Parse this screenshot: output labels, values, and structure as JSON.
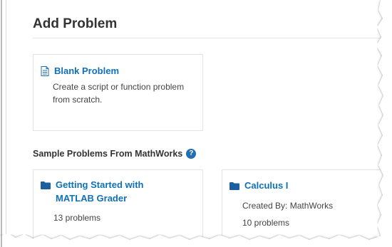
{
  "page": {
    "title": "Add Problem"
  },
  "blank_problem": {
    "label": "Blank Problem",
    "description": "Create a script or function problem from scratch.",
    "icon": "document-icon"
  },
  "samples": {
    "heading": "Sample Problems From MathWorks",
    "help_icon_glyph": "?",
    "cards": [
      {
        "title": "Getting Started with MATLAB Grader",
        "count": "13 problems",
        "icon": "folder-icon"
      },
      {
        "title": "Calculus I",
        "created_by": "Created By: MathWorks",
        "count": "10 problems",
        "icon": "folder-icon"
      }
    ]
  },
  "colors": {
    "link": "#0e71b8",
    "help_icon": "#1f6fb2",
    "text": "#333333"
  }
}
